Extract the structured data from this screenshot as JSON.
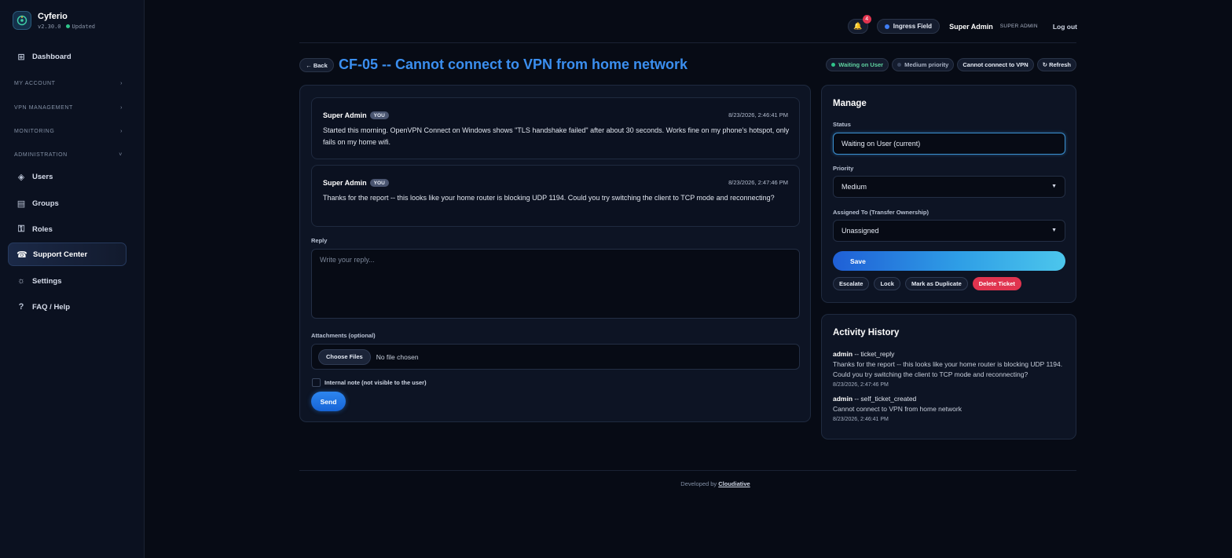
{
  "app": {
    "name": "Cyferio",
    "version": "v2.30.0",
    "status": "Updated"
  },
  "sidebar": {
    "dashboard": "Dashboard",
    "sections": [
      "MY ACCOUNT",
      "VPN MANAGEMENT",
      "MONITORING",
      "ADMINISTRATION"
    ],
    "items": [
      "Users",
      "Groups",
      "Roles",
      "Support Center",
      "Settings",
      "FAQ / Help"
    ]
  },
  "topbar": {
    "notifications": "4",
    "field": "Ingress Field",
    "user": "Super Admin",
    "role": "SUPER ADMIN",
    "logout": "Log out"
  },
  "ticket": {
    "back": "← Back",
    "title": "CF-05 -- Cannot connect to VPN from home network",
    "chips": [
      "Waiting on User",
      "Medium priority",
      "Cannot connect to VPN",
      "↻ Refresh"
    ],
    "messages": [
      {
        "author": "Super Admin",
        "badge": "YOU",
        "time": "8/23/2026, 2:46:41 PM",
        "body": "Started this morning. OpenVPN Connect on Windows shows \"TLS handshake failed\" after about 30 seconds. Works fine on my phone's hotspot, only fails on my home wifi."
      },
      {
        "author": "Super Admin",
        "badge": "YOU",
        "time": "8/23/2026, 2:47:46 PM",
        "body": "Thanks for the report -- this looks like your home router is blocking UDP 1194. Could you try switching the client to TCP mode and reconnecting?"
      }
    ],
    "reply_label": "Reply",
    "reply_placeholder": "Write your reply...",
    "attach_label": "Attachments (optional)",
    "choose_files": "Choose Files",
    "no_file": "No file chosen",
    "internal_note": "Internal note  (not visible to the user)",
    "send": "Send"
  },
  "manage": {
    "title": "Manage",
    "status_label": "Status",
    "status_value": "Waiting on User (current)",
    "priority_label": "Priority",
    "priority_value": "Medium",
    "assigned_label": "Assigned To (Transfer Ownership)",
    "assigned_value": "Unassigned",
    "save": "Save",
    "actions": [
      "Escalate",
      "Lock",
      "Mark as Duplicate",
      "Delete Ticket"
    ]
  },
  "activity": {
    "title": "Activity History",
    "entries": [
      {
        "user": "admin",
        "action": " -- ticket_reply",
        "text": "Thanks for the report -- this looks like your home router is blocking UDP 1194. Could you try switching the client to TCP mode and reconnecting?",
        "time": "8/23/2026, 2:47:46 PM"
      },
      {
        "user": "admin",
        "action": " -- self_ticket_created",
        "text": "Cannot connect to VPN from home network",
        "time": "8/23/2026, 2:46:41 PM"
      }
    ]
  },
  "footer": {
    "prefix": "Developed by ",
    "brand": "Cloudiative"
  },
  "colors": {
    "accent": "#3b8ff0",
    "danger": "#e0344f",
    "success": "#2fc48a",
    "background": "#070b15"
  }
}
